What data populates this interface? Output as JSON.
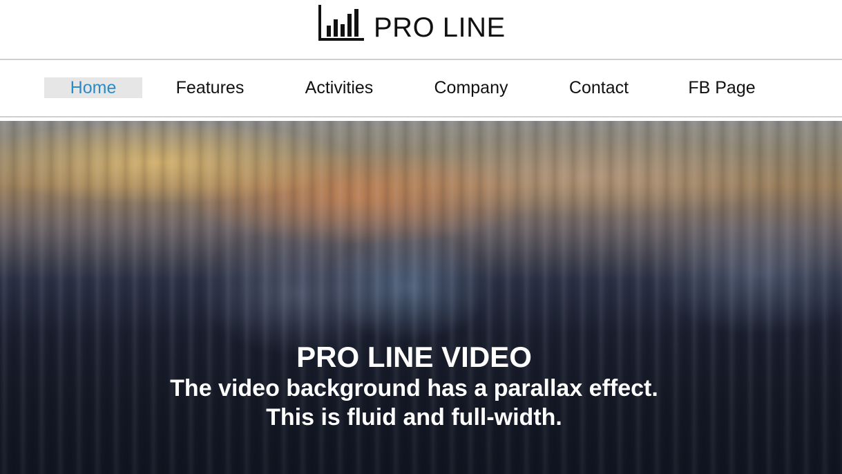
{
  "header": {
    "logo_icon": "bar-chart-icon",
    "logo_text": "PRO LINE"
  },
  "nav": {
    "items": [
      {
        "label": "Home",
        "active": true
      },
      {
        "label": "Features",
        "active": false
      },
      {
        "label": "Activities",
        "active": false
      },
      {
        "label": "Company",
        "active": false
      },
      {
        "label": "Contact",
        "active": false
      },
      {
        "label": "FB Page",
        "active": false
      }
    ]
  },
  "hero": {
    "title": "PRO LINE VIDEO",
    "line1": "The video background has a parallax effect.",
    "line2": "This is fluid and full-width."
  },
  "colors": {
    "active_nav_text": "#2a8cc7",
    "active_nav_bg": "#e6e6e6",
    "divider": "#cfcfcf"
  }
}
